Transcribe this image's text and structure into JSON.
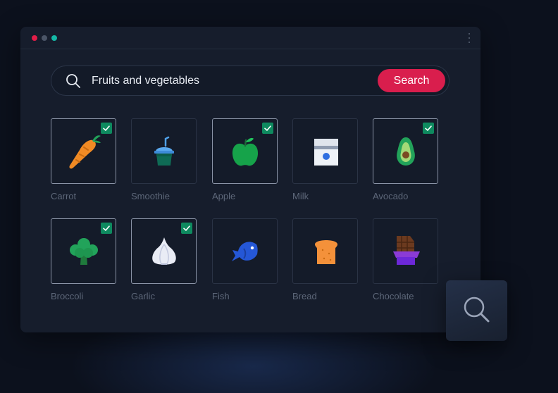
{
  "search": {
    "value": "Fruits and vegetables",
    "button_label": "Search"
  },
  "items": [
    {
      "label": "Carrot",
      "icon": "carrot-icon",
      "selected": true
    },
    {
      "label": "Smoothie",
      "icon": "smoothie-icon",
      "selected": false
    },
    {
      "label": "Apple",
      "icon": "apple-icon",
      "selected": true
    },
    {
      "label": "Milk",
      "icon": "milk-icon",
      "selected": false
    },
    {
      "label": "Avocado",
      "icon": "avocado-icon",
      "selected": true
    },
    {
      "label": "Broccoli",
      "icon": "broccoli-icon",
      "selected": true
    },
    {
      "label": "Garlic",
      "icon": "garlic-icon",
      "selected": true
    },
    {
      "label": "Fish",
      "icon": "fish-icon",
      "selected": false
    },
    {
      "label": "Bread",
      "icon": "bread-icon",
      "selected": false
    },
    {
      "label": "Chocolate",
      "icon": "chocolate-icon",
      "selected": false
    }
  ],
  "colors": {
    "accent": "#d91e4d",
    "check": "#0e8a5f",
    "background": "#0c111d",
    "window": "#161d2c"
  }
}
